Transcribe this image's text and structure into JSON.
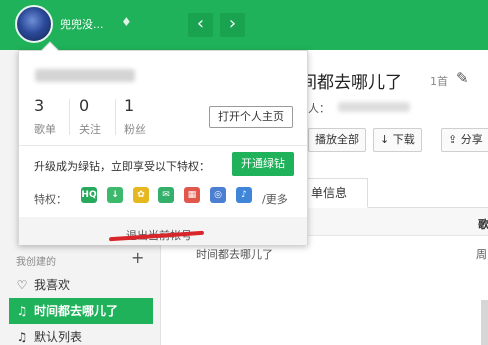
{
  "header": {
    "username": "兜兜没...",
    "diamond_icon": "diamond-icon",
    "back_icon": "chevron-left-icon",
    "forward_icon": "chevron-right-icon"
  },
  "popup": {
    "stats": [
      {
        "value": "3",
        "label": "歌单"
      },
      {
        "value": "0",
        "label": "关注"
      },
      {
        "value": "1",
        "label": "粉丝"
      }
    ],
    "homepage_label": "打开个人主页",
    "upgrade_text": "升级成为绿钻，立即享受以下特权：",
    "open_label": "开通绿钻",
    "privileges_label": "特权：",
    "privilege_icons": [
      {
        "name": "hq-icon",
        "glyph": "HQ",
        "color": "#27a95c"
      },
      {
        "name": "download-icon",
        "glyph": "↓",
        "color": "#3cb96d"
      },
      {
        "name": "skin-icon",
        "glyph": "✿",
        "color": "#e6b81f"
      },
      {
        "name": "message-icon",
        "glyph": "✉",
        "color": "#33b06a"
      },
      {
        "name": "gift-icon",
        "glyph": "▦",
        "color": "#e2574c"
      },
      {
        "name": "badge-icon",
        "glyph": "◎",
        "color": "#4a7fd1"
      },
      {
        "name": "lyrics-icon",
        "glyph": "♪",
        "color": "#3f86d8"
      }
    ],
    "more_label": "/更多",
    "logout_label": "退出当前帐号"
  },
  "sidebar": {
    "section_label": "我创建的",
    "add_icon": "plus-icon",
    "items": [
      {
        "icon": "heart-icon",
        "glyph": "♡",
        "label": "我喜欢",
        "active": false
      },
      {
        "icon": "music-note-icon",
        "glyph": "♫",
        "label": "时间都去哪儿了",
        "active": true
      },
      {
        "icon": "music-note-icon",
        "glyph": "♫",
        "label": "默认列表",
        "active": false
      }
    ]
  },
  "main": {
    "title": "间都去哪儿了",
    "count": "1首",
    "creator_label": "人：",
    "buttons": [
      {
        "label": "播放全部"
      },
      {
        "label": "↓ 下载"
      },
      {
        "label": "⇪ 分享"
      }
    ],
    "tab_label": "单信息",
    "column_header": "歌",
    "song_title": "时间都去哪儿了",
    "song_artist": "周"
  },
  "colors": {
    "brand_green": "#1fb25a",
    "accent_red": "#d9262b"
  }
}
